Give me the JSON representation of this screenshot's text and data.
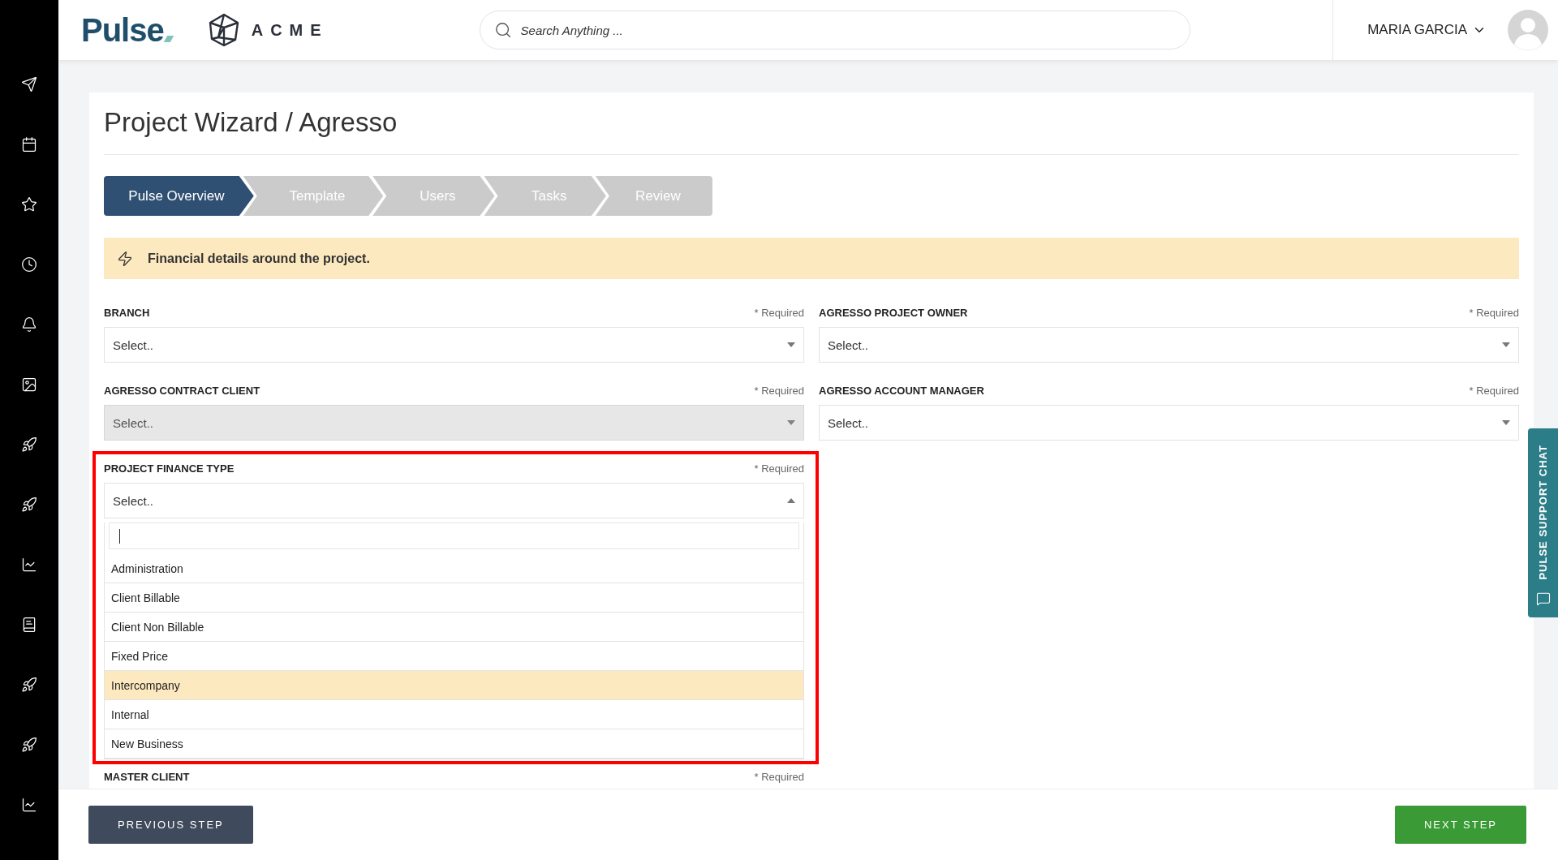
{
  "header": {
    "logo": "Pulse",
    "company": "ACME",
    "search": {
      "placeholder": "Search Anything ..."
    },
    "user": "MARIA GARCIA"
  },
  "page": {
    "title": "Project Wizard / Agresso",
    "steps": [
      {
        "label": "Pulse Overview",
        "selected": true
      },
      {
        "label": "Template",
        "selected": false
      },
      {
        "label": "Users",
        "selected": false
      },
      {
        "label": "Tasks",
        "selected": false
      },
      {
        "label": "Review",
        "selected": false
      }
    ],
    "notice": "Financial details around the project.",
    "fields": [
      {
        "label": "BRANCH",
        "required": "* Required",
        "value": "Select..",
        "disabled": false,
        "expanded": false,
        "annotated": false
      },
      {
        "label": "AGRESSO PROJECT OWNER",
        "required": "* Required",
        "value": "Select..",
        "disabled": false,
        "expanded": false,
        "annotated": false
      },
      {
        "label": "AGRESSO CONTRACT CLIENT",
        "required": "* Required",
        "value": "Select..",
        "disabled": true,
        "expanded": false,
        "annotated": false
      },
      {
        "label": "AGRESSO ACCOUNT MANAGER",
        "required": "* Required",
        "value": "Select..",
        "disabled": false,
        "expanded": false,
        "annotated": false
      },
      {
        "label": "PROJECT FINANCE TYPE",
        "required": "* Required",
        "value": "Select..",
        "disabled": false,
        "expanded": true,
        "annotated": true,
        "options": [
          {
            "label": "Administration",
            "selected": false
          },
          {
            "label": "Client Billable",
            "selected": false
          },
          {
            "label": "Client Non Billable",
            "selected": false
          },
          {
            "label": "Fixed Price",
            "selected": false
          },
          {
            "label": "Intercompany",
            "selected": true
          },
          {
            "label": "Internal",
            "selected": false
          },
          {
            "label": "New Business",
            "selected": false
          }
        ]
      }
    ],
    "master_client": {
      "label": "MASTER CLIENT",
      "required": "* Required"
    }
  },
  "footer": {
    "previous": "PREVIOUS STEP",
    "next": "NEXT STEP"
  },
  "support_chat": "PULSE SUPPORT CHAT"
}
